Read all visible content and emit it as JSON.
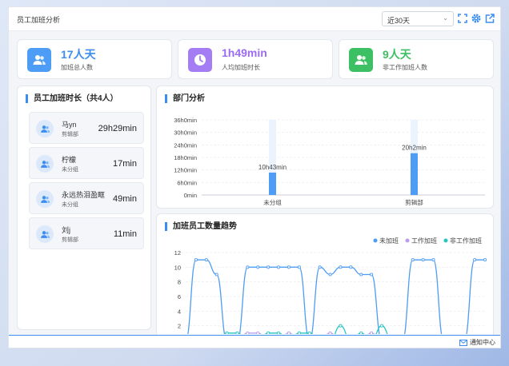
{
  "header": {
    "title": "员工加班分析",
    "range_select": "近30天"
  },
  "stats": [
    {
      "value": "17人天",
      "label": "加班总人数",
      "color": "#3b8ef0",
      "icon": "users-icon"
    },
    {
      "value": "1h49min",
      "label": "人均加班时长",
      "color": "#9b6cf0",
      "icon": "clock-icon"
    },
    {
      "value": "9人天",
      "label": "非工作加班人数",
      "color": "#3dbf63",
      "icon": "users-icon"
    }
  ],
  "employees_panel": {
    "title": "员工加班时长（共4人）",
    "items": [
      {
        "name": "马yn",
        "dept": "剪辑部",
        "duration": "29h29min"
      },
      {
        "name": "柠檬",
        "dept": "未分组",
        "duration": "17min"
      },
      {
        "name": "永远热泪盈眶",
        "dept": "未分组",
        "duration": "49min"
      },
      {
        "name": "刘j",
        "dept": "剪辑部",
        "duration": "11min"
      }
    ]
  },
  "dept_panel": {
    "title": "部门分析"
  },
  "trend_panel": {
    "title": "加班员工数量趋势"
  },
  "footer": {
    "notification": "通知中心"
  },
  "chart_data": [
    {
      "type": "bar",
      "title": "部门分析",
      "categories": [
        "未分组",
        "剪辑部"
      ],
      "values": [
        10.72,
        20.03
      ],
      "value_labels": [
        "10h43min",
        "20h2min"
      ],
      "unit": "hours",
      "ylim": [
        0,
        36
      ],
      "yticks": [
        "0min",
        "6h0min",
        "12h0min",
        "18h0min",
        "24h0min",
        "30h0min",
        "36h0min"
      ],
      "color": "#4d9cf5",
      "background_color": "#ebf4fe",
      "grid": true
    },
    {
      "type": "line",
      "title": "加班员工数量趋势",
      "ylim": [
        0,
        12
      ],
      "yticks": [
        2,
        4,
        6,
        8,
        10,
        12
      ],
      "legend_position": "top-right",
      "series": [
        {
          "name": "未加班",
          "color": "#4d9cf5",
          "values": [
            0,
            11,
            11,
            9,
            0,
            0,
            10,
            10,
            10,
            10,
            10,
            10,
            0,
            10,
            9,
            10,
            10,
            9,
            9,
            0,
            0,
            0,
            11,
            11,
            11,
            0,
            0,
            0,
            11,
            11
          ]
        },
        {
          "name": "工作加班",
          "color": "#b99bf0",
          "values": [
            0,
            0,
            0,
            0,
            0,
            0,
            1,
            1,
            0,
            0,
            1,
            0,
            0,
            0,
            1,
            0,
            0,
            0,
            1,
            0,
            0,
            0,
            0,
            0,
            0,
            0,
            0,
            0,
            0,
            0
          ]
        },
        {
          "name": "非工作加班",
          "color": "#26c6c0",
          "values": [
            0,
            0,
            0,
            0,
            1,
            1,
            0,
            0,
            1,
            1,
            0,
            1,
            1,
            0,
            0,
            2,
            0,
            1,
            0,
            2,
            0,
            0,
            0,
            0,
            0,
            0,
            0,
            0,
            0,
            0
          ]
        }
      ]
    }
  ]
}
